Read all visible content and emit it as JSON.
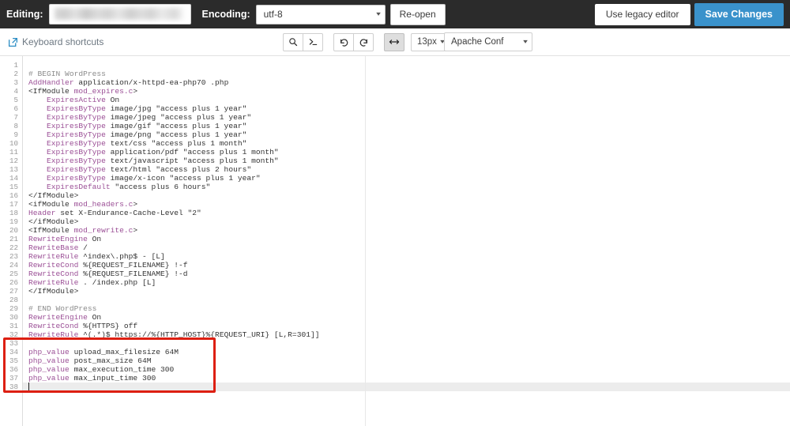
{
  "topbar": {
    "editing_label": "Editing:",
    "editing_value": "",
    "encoding_label": "Encoding:",
    "encoding_value": "utf-8",
    "reopen_label": "Re-open",
    "legacy_editor_label": "Use legacy editor",
    "save_label": "Save Changes",
    "background_color": "#2b2b2b",
    "save_button_color": "#3a92cb"
  },
  "toolbar": {
    "keyboard_shortcuts_label": "Keyboard shortcuts",
    "keyboard_shortcuts_icon": "external-link-icon",
    "buttons": [
      {
        "name": "search-icon",
        "title": "Search"
      },
      {
        "name": "command-prompt-icon",
        "title": "Command"
      },
      {
        "name": "undo-icon",
        "title": "Undo"
      },
      {
        "name": "redo-icon",
        "title": "Redo"
      },
      {
        "name": "word-wrap-icon",
        "title": "Toggle word wrap",
        "active": true
      }
    ],
    "font_size_value": "13px",
    "mode_value": "Apache Conf"
  },
  "editor": {
    "total_lines": 38,
    "active_line": 38,
    "cursor_line": 38,
    "cursor_column": 1,
    "lines": [
      {
        "n": 1,
        "tokens": []
      },
      {
        "n": 2,
        "tokens": [
          {
            "t": "com",
            "s": "# BEGIN WordPress"
          }
        ]
      },
      {
        "n": 3,
        "tokens": [
          {
            "t": "dir",
            "s": "AddHandler"
          },
          {
            "t": "txt",
            "s": " application/x-httpd-ea-php70 .php"
          }
        ]
      },
      {
        "n": 4,
        "tokens": [
          {
            "t": "txt",
            "s": "<IfModule "
          },
          {
            "t": "mod",
            "s": "mod_expires.c"
          },
          {
            "t": "txt",
            "s": ">"
          }
        ]
      },
      {
        "n": 5,
        "tokens": [
          {
            "t": "txt",
            "s": "    "
          },
          {
            "t": "dir",
            "s": "ExpiresActive"
          },
          {
            "t": "txt",
            "s": " On"
          }
        ]
      },
      {
        "n": 6,
        "tokens": [
          {
            "t": "txt",
            "s": "    "
          },
          {
            "t": "dir",
            "s": "ExpiresByType"
          },
          {
            "t": "txt",
            "s": " image/jpg \"access plus 1 year\""
          }
        ]
      },
      {
        "n": 7,
        "tokens": [
          {
            "t": "txt",
            "s": "    "
          },
          {
            "t": "dir",
            "s": "ExpiresByType"
          },
          {
            "t": "txt",
            "s": " image/jpeg \"access plus 1 year\""
          }
        ]
      },
      {
        "n": 8,
        "tokens": [
          {
            "t": "txt",
            "s": "    "
          },
          {
            "t": "dir",
            "s": "ExpiresByType"
          },
          {
            "t": "txt",
            "s": " image/gif \"access plus 1 year\""
          }
        ]
      },
      {
        "n": 9,
        "tokens": [
          {
            "t": "txt",
            "s": "    "
          },
          {
            "t": "dir",
            "s": "ExpiresByType"
          },
          {
            "t": "txt",
            "s": " image/png \"access plus 1 year\""
          }
        ]
      },
      {
        "n": 10,
        "tokens": [
          {
            "t": "txt",
            "s": "    "
          },
          {
            "t": "dir",
            "s": "ExpiresByType"
          },
          {
            "t": "txt",
            "s": " text/css \"access plus 1 month\""
          }
        ]
      },
      {
        "n": 11,
        "tokens": [
          {
            "t": "txt",
            "s": "    "
          },
          {
            "t": "dir",
            "s": "ExpiresByType"
          },
          {
            "t": "txt",
            "s": " application/pdf \"access plus 1 month\""
          }
        ]
      },
      {
        "n": 12,
        "tokens": [
          {
            "t": "txt",
            "s": "    "
          },
          {
            "t": "dir",
            "s": "ExpiresByType"
          },
          {
            "t": "txt",
            "s": " text/javascript \"access plus 1 month\""
          }
        ]
      },
      {
        "n": 13,
        "tokens": [
          {
            "t": "txt",
            "s": "    "
          },
          {
            "t": "dir",
            "s": "ExpiresByType"
          },
          {
            "t": "txt",
            "s": " text/html \"access plus 2 hours\""
          }
        ]
      },
      {
        "n": 14,
        "tokens": [
          {
            "t": "txt",
            "s": "    "
          },
          {
            "t": "dir",
            "s": "ExpiresByType"
          },
          {
            "t": "txt",
            "s": " image/x-icon \"access plus 1 year\""
          }
        ]
      },
      {
        "n": 15,
        "tokens": [
          {
            "t": "txt",
            "s": "    "
          },
          {
            "t": "dir",
            "s": "ExpiresDefault"
          },
          {
            "t": "txt",
            "s": " \"access plus 6 hours\""
          }
        ]
      },
      {
        "n": 16,
        "tokens": [
          {
            "t": "txt",
            "s": "</IfModule>"
          }
        ]
      },
      {
        "n": 17,
        "tokens": [
          {
            "t": "txt",
            "s": "<ifModule "
          },
          {
            "t": "mod",
            "s": "mod_headers.c"
          },
          {
            "t": "txt",
            "s": ">"
          }
        ]
      },
      {
        "n": 18,
        "tokens": [
          {
            "t": "dir",
            "s": "Header"
          },
          {
            "t": "txt",
            "s": " set X-Endurance-Cache-Level \"2\""
          }
        ]
      },
      {
        "n": 19,
        "tokens": [
          {
            "t": "txt",
            "s": "</ifModule>"
          }
        ]
      },
      {
        "n": 20,
        "tokens": [
          {
            "t": "txt",
            "s": "<IfModule "
          },
          {
            "t": "mod",
            "s": "mod_rewrite.c"
          },
          {
            "t": "txt",
            "s": ">"
          }
        ]
      },
      {
        "n": 21,
        "tokens": [
          {
            "t": "dir",
            "s": "RewriteEngine"
          },
          {
            "t": "txt",
            "s": " On"
          }
        ]
      },
      {
        "n": 22,
        "tokens": [
          {
            "t": "dir",
            "s": "RewriteBase"
          },
          {
            "t": "txt",
            "s": " /"
          }
        ]
      },
      {
        "n": 23,
        "tokens": [
          {
            "t": "dir",
            "s": "RewriteRule"
          },
          {
            "t": "txt",
            "s": " ^index\\.php$ - [L]"
          }
        ]
      },
      {
        "n": 24,
        "tokens": [
          {
            "t": "dir",
            "s": "RewriteCond"
          },
          {
            "t": "txt",
            "s": " %{REQUEST_FILENAME} !-f"
          }
        ]
      },
      {
        "n": 25,
        "tokens": [
          {
            "t": "dir",
            "s": "RewriteCond"
          },
          {
            "t": "txt",
            "s": " %{REQUEST_FILENAME} !-d"
          }
        ]
      },
      {
        "n": 26,
        "tokens": [
          {
            "t": "dir",
            "s": "RewriteRule"
          },
          {
            "t": "txt",
            "s": " . /index.php [L]"
          }
        ]
      },
      {
        "n": 27,
        "tokens": [
          {
            "t": "txt",
            "s": "</IfModule>"
          }
        ]
      },
      {
        "n": 28,
        "tokens": []
      },
      {
        "n": 29,
        "tokens": [
          {
            "t": "com",
            "s": "# END WordPress"
          }
        ]
      },
      {
        "n": 30,
        "tokens": [
          {
            "t": "dir",
            "s": "RewriteEngine"
          },
          {
            "t": "txt",
            "s": " On"
          }
        ]
      },
      {
        "n": 31,
        "tokens": [
          {
            "t": "dir",
            "s": "RewriteCond"
          },
          {
            "t": "txt",
            "s": " %{HTTPS} off"
          }
        ]
      },
      {
        "n": 32,
        "tokens": [
          {
            "t": "dir",
            "s": "RewriteRule"
          },
          {
            "t": "txt",
            "s": " ^(.*)$ https://%{HTTP_HOST}%{REQUEST_URI} [L,R=301]]"
          }
        ]
      },
      {
        "n": 33,
        "tokens": []
      },
      {
        "n": 34,
        "tokens": [
          {
            "t": "dir",
            "s": "php_value"
          },
          {
            "t": "txt",
            "s": " upload_max_filesize 64M"
          }
        ]
      },
      {
        "n": 35,
        "tokens": [
          {
            "t": "dir",
            "s": "php_value"
          },
          {
            "t": "txt",
            "s": " post_max_size 64M"
          }
        ]
      },
      {
        "n": 36,
        "tokens": [
          {
            "t": "dir",
            "s": "php_value"
          },
          {
            "t": "txt",
            "s": " max_execution_time 300"
          }
        ]
      },
      {
        "n": 37,
        "tokens": [
          {
            "t": "dir",
            "s": "php_value"
          },
          {
            "t": "txt",
            "s": " max_input_time 300"
          }
        ]
      },
      {
        "n": 38,
        "tokens": []
      }
    ],
    "annotation": {
      "color": "#dd1f12",
      "covers_lines": "33-38"
    }
  }
}
